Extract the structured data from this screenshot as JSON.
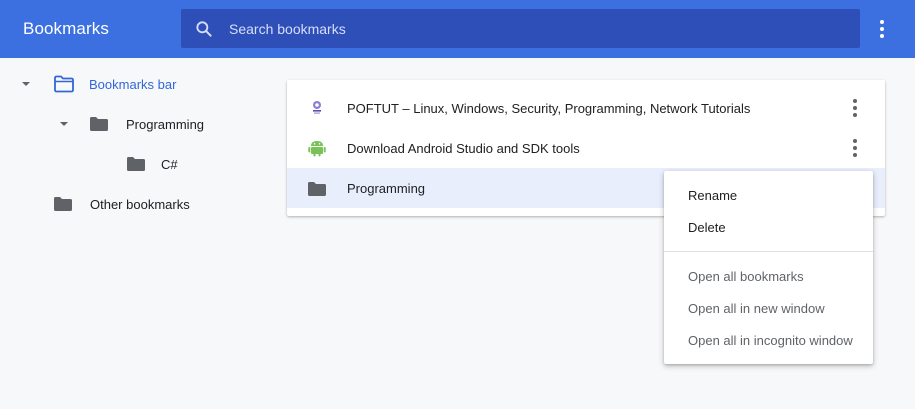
{
  "colors": {
    "header_bg": "#3c6fe0",
    "search_bg": "#2e4fb8",
    "accent": "#3367d6",
    "folder_gray": "#5f6368",
    "android_green": "#78c257"
  },
  "header": {
    "title": "Bookmarks",
    "search": {
      "placeholder": "Search bookmarks",
      "icon": "search-icon"
    },
    "menu_icon": "more-vert-icon"
  },
  "sidebar": {
    "items": [
      {
        "label": "Bookmarks bar",
        "icon": "folder-open-icon",
        "expanded": true,
        "selected": true
      },
      {
        "label": "Programming",
        "icon": "folder-icon",
        "expanded": true,
        "selected": false
      },
      {
        "label": "C#",
        "icon": "folder-icon",
        "expanded": false,
        "selected": false
      },
      {
        "label": "Other bookmarks",
        "icon": "folder-icon",
        "expanded": false,
        "selected": false
      }
    ]
  },
  "list": {
    "items": [
      {
        "title": "POFTUT – Linux, Windows, Security, Programming, Network Tutorials",
        "icon": "poftut-favicon"
      },
      {
        "title": "Download Android Studio and SDK tools",
        "icon": "android-icon"
      },
      {
        "title": "Programming",
        "icon": "folder-icon"
      }
    ]
  },
  "context_menu": {
    "items": [
      {
        "label": "Rename"
      },
      {
        "label": "Delete"
      },
      {
        "label": "Open all bookmarks"
      },
      {
        "label": "Open all in new window"
      },
      {
        "label": "Open all in incognito window"
      }
    ]
  }
}
